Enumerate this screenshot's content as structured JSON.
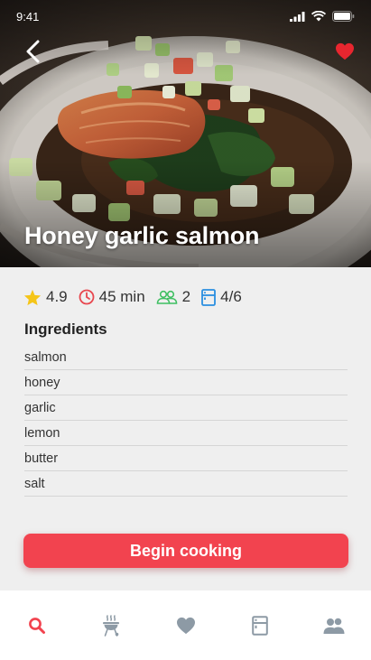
{
  "status_bar": {
    "time": "9:41"
  },
  "recipe": {
    "title": "Honey garlic salmon",
    "favorited": true
  },
  "stats": {
    "rating": "4.9",
    "time": "45 min",
    "servings": "2",
    "difficulty": "4/6"
  },
  "ingredients": {
    "heading": "Ingredients",
    "items": [
      "salmon",
      "honey",
      "garlic",
      "lemon",
      "butter",
      "salt"
    ]
  },
  "actions": {
    "begin_label": "Begin cooking"
  },
  "tab_bar": {
    "tabs": [
      {
        "icon": "search-icon",
        "active": true
      },
      {
        "icon": "grill-icon",
        "active": false
      },
      {
        "icon": "heart-icon",
        "active": false
      },
      {
        "icon": "fridge-icon",
        "active": false
      },
      {
        "icon": "people-icon",
        "active": false
      }
    ]
  },
  "colors": {
    "accent": "#f2434f",
    "star": "#f5c518",
    "clock": "#e8474f",
    "servings": "#3fbf62",
    "difficulty": "#2a8fe0",
    "tab_inactive": "#8d9aa5"
  }
}
